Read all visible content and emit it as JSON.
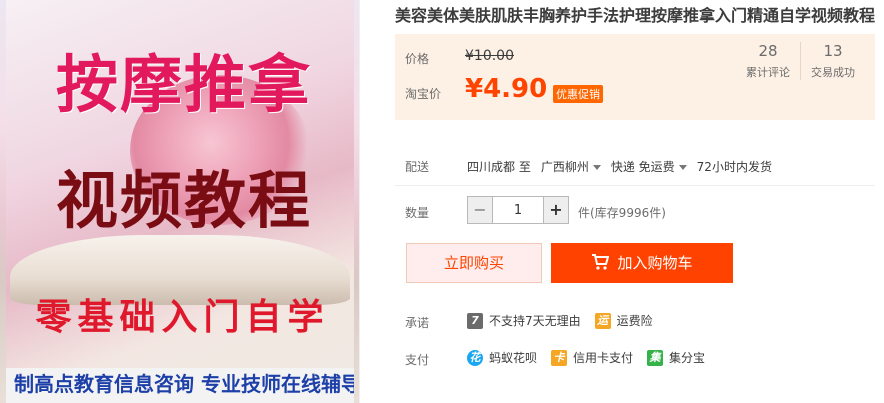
{
  "image": {
    "title_line_1": "按摩推拿",
    "title_line_2": "视频教程",
    "subtitle": "零基础入门自学",
    "footer_text": "制高点教育信息咨询  专业技师在线辅导"
  },
  "product": {
    "title": "美容美体美肤肌肤丰胸养护手法护理按摩推拿入门精通自学视频教程"
  },
  "price": {
    "original_label": "价格",
    "original_value": "¥10.00",
    "taobao_label": "淘宝价",
    "current_value": "¥4.90",
    "promo_badge": "优惠促销"
  },
  "stats": [
    {
      "value": "28",
      "label": "累计评论"
    },
    {
      "value": "13",
      "label": "交易成功"
    }
  ],
  "delivery": {
    "label": "配送",
    "from": "四川成都 至",
    "to": "广西柳州",
    "method": "快递 免运费",
    "dispatch": "72小时内发货"
  },
  "quantity": {
    "label": "数量",
    "minus": "−",
    "value": "1",
    "plus": "+",
    "stock": "件(库存9996件)"
  },
  "actions": {
    "buy_now": "立即购买",
    "add_to_cart": "加入购物车"
  },
  "promise": {
    "label": "承诺",
    "items": [
      {
        "icon": "7-day-icon",
        "glyph": "7",
        "text": "不支持7天无理由",
        "color": "#666666"
      },
      {
        "icon": "shipping-insurance-icon",
        "glyph": "运",
        "text": "运费险",
        "color": "#f5a623"
      }
    ]
  },
  "payment": {
    "label": "支付",
    "items": [
      {
        "icon": "huabei-icon",
        "glyph": "花",
        "text": "蚂蚁花呗",
        "color": "#1aa6f0"
      },
      {
        "icon": "credit-card-icon",
        "glyph": "卡",
        "text": "信用卡支付",
        "color": "#f5a623"
      },
      {
        "icon": "jifenbao-icon",
        "glyph": "集",
        "text": "集分宝",
        "color": "#36b24a"
      }
    ]
  },
  "colors": {
    "accent": "#ff4400",
    "cart_button": "#ff4200",
    "price_bg": "#fdf0e5"
  }
}
